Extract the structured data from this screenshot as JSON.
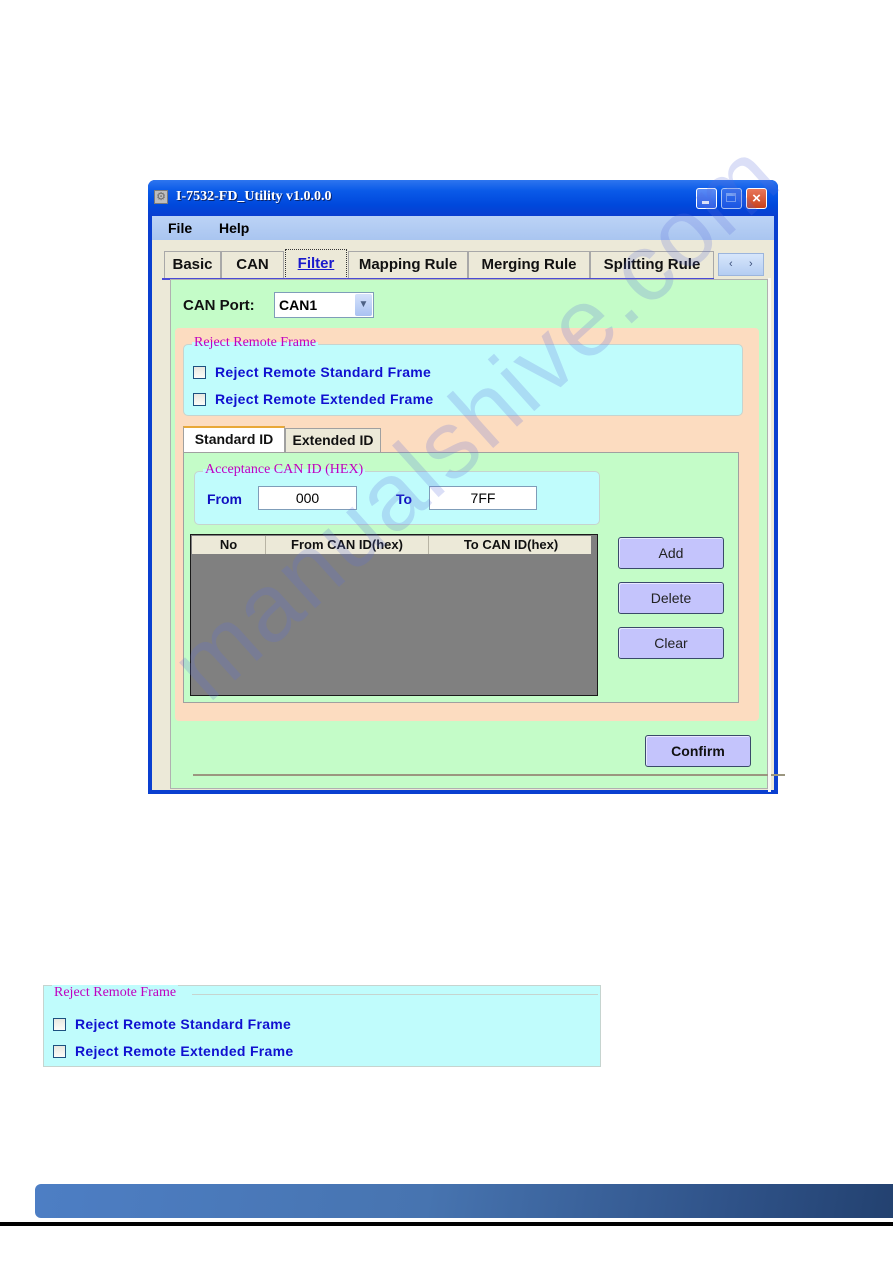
{
  "window": {
    "title": "I-7532-FD_Utility v1.0.0.0",
    "icon": "gear-icon",
    "controls": {
      "minimize": "minimize-icon",
      "maximize": "maximize-icon",
      "close": "×"
    }
  },
  "menu": [
    "File",
    "Help"
  ],
  "tabs": [
    {
      "label": "Basic",
      "active": false
    },
    {
      "label": "CAN",
      "active": false
    },
    {
      "label": "Filter",
      "active": true
    },
    {
      "label": "Mapping Rule",
      "active": false
    },
    {
      "label": "Merging Rule",
      "active": false
    },
    {
      "label": "Splitting Rule",
      "active": false
    }
  ],
  "tab_scroll": {
    "left": "‹",
    "right": "›"
  },
  "filter": {
    "can_port_label": "CAN Port:",
    "can_port_value": "CAN1",
    "reject_remote": {
      "legend": "Reject Remote Frame",
      "options": [
        {
          "label": "Reject Remote Standard Frame",
          "checked": false
        },
        {
          "label": "Reject Remote Extended Frame",
          "checked": false
        }
      ]
    },
    "subtabs": [
      {
        "label": "Standard ID",
        "active": true
      },
      {
        "label": "Extended ID",
        "active": false
      }
    ],
    "acceptance": {
      "legend": "Acceptance CAN ID (HEX)",
      "from_label": "From",
      "from_value": "000",
      "to_label": "To",
      "to_value": "7FF"
    },
    "table": {
      "columns": [
        "No",
        "From CAN ID(hex)",
        "To CAN ID(hex)"
      ],
      "rows": []
    },
    "buttons": {
      "add": "Add",
      "delete": "Delete",
      "clear": "Clear"
    },
    "confirm": "Confirm"
  },
  "detail_panel": {
    "legend": "Reject Remote Frame",
    "options": [
      {
        "label": "Reject Remote Standard Frame",
        "checked": false
      },
      {
        "label": "Reject Remote Extended Frame",
        "checked": false
      }
    ]
  },
  "watermark": "manualshive.com"
}
